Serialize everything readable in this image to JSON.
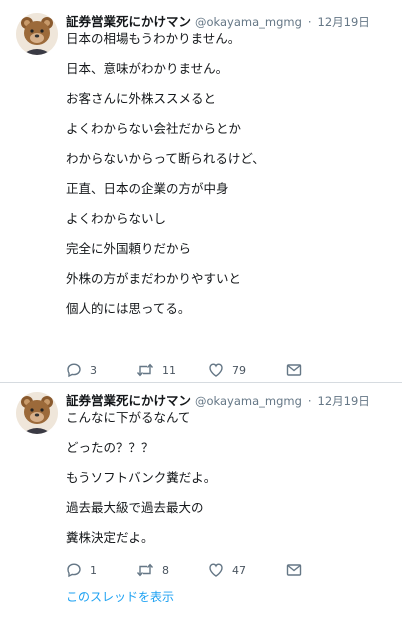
{
  "tweets": [
    {
      "author_name": "証券営業死にかけマン",
      "handle": "@okayama_mgmg",
      "separator": "·",
      "date": "12月19日",
      "lines": [
        "日本の相場もうわかりません。",
        "",
        "日本、意味がわかりません。",
        "",
        "お客さんに外株ススメると",
        "",
        "よくわからない会社だからとか",
        "",
        "わからないからって断られるけど、",
        "",
        "正直、日本の企業の方が中身",
        "",
        "よくわからないし",
        "",
        "完全に外国頼りだから",
        "",
        "外株の方がまだわかりやすいと",
        "",
        "個人的には思ってる。"
      ],
      "replies": "3",
      "retweets": "11",
      "likes": "79"
    },
    {
      "author_name": "証券営業死にかけマン",
      "handle": "@okayama_mgmg",
      "separator": "·",
      "date": "12月19日",
      "lines": [
        "こんなに下がるなんて",
        "",
        "どったの？？？",
        "",
        "もうソフトバンク糞だよ。",
        "",
        "過去最大級で過去最大の",
        "",
        "糞株決定だよ。"
      ],
      "replies": "1",
      "retweets": "8",
      "likes": "47",
      "thread_link": "このスレッドを表示"
    }
  ],
  "icons": {
    "reply": "reply-icon",
    "retweet": "retweet-icon",
    "like": "heart-icon",
    "share": "envelope-icon",
    "avatar": "bear-mask-avatar"
  },
  "colors": {
    "link": "#1da1f2",
    "secondary_text": "#657786",
    "divider": "#d6dbe0"
  }
}
